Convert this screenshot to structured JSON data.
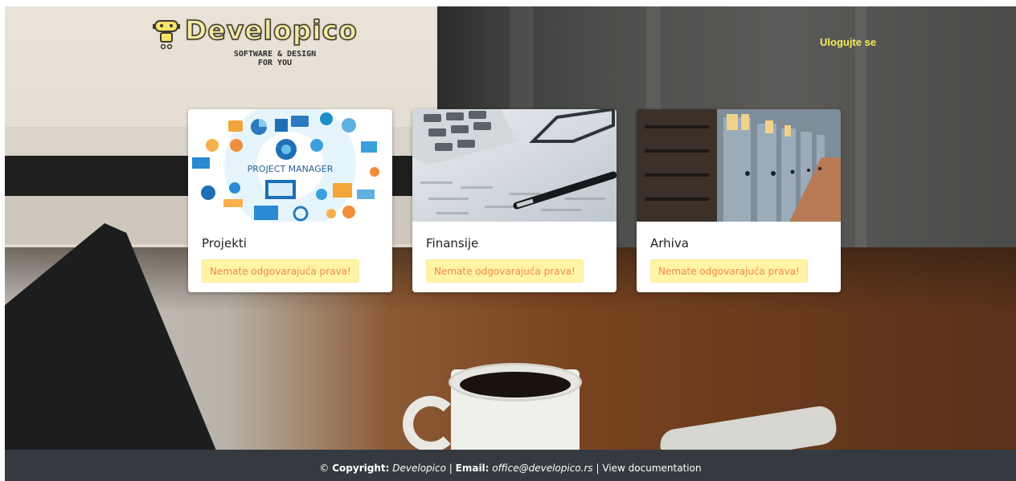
{
  "header": {
    "logo_title": "Developico",
    "logo_subtitle_line1": "SOFTWARE & DESIGN",
    "logo_subtitle_line2": "FOR YOU",
    "login_label": "Ulogujte se"
  },
  "cards": [
    {
      "title": "Projekti",
      "alert": "Nemate odgovarajuća prava!",
      "image_text": "PROJECT MANAGER"
    },
    {
      "title": "Finansije",
      "alert": "Nemate odgovarajuća prava!"
    },
    {
      "title": "Arhiva",
      "alert": "Nemate odgovarajuća prava!"
    }
  ],
  "footer": {
    "copyright_symbol": "©",
    "copyright_label": "Copyright:",
    "copyright_value": "Developico",
    "separator": "|",
    "email_label": "Email:",
    "email_value": "office@developico.rs",
    "docs_link": "View documentation"
  },
  "colors": {
    "login_link": "#f6ec57",
    "alert_bg": "#fff3a6",
    "alert_text": "#f08a4b",
    "footer_bg": "#343a40"
  }
}
